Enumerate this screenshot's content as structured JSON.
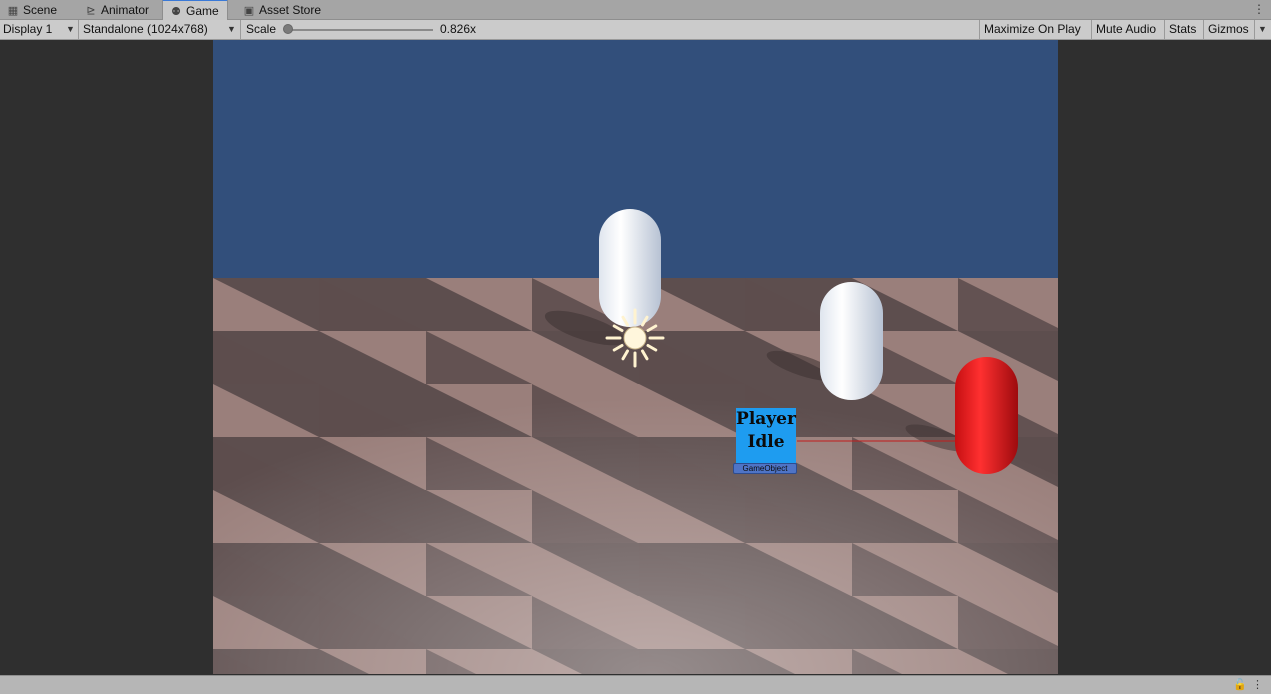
{
  "tabs": [
    {
      "label": "Scene",
      "icon": "grid-icon"
    },
    {
      "label": "Animator",
      "icon": "animator-icon"
    },
    {
      "label": "Game",
      "icon": "gamepad-icon",
      "active": true
    },
    {
      "label": "Asset Store",
      "icon": "shopping-bag-icon"
    }
  ],
  "toolbar": {
    "display": "Display 1",
    "resolution": "Standalone (1024x768)",
    "scale_label": "Scale",
    "scale_value": "0.826x",
    "maximize": "Maximize On Play",
    "mute": "Mute Audio",
    "stats": "Stats",
    "gizmos": "Gizmos"
  },
  "scene": {
    "player_line1": "Player",
    "player_line2": "Idle",
    "tag": "GameObject"
  },
  "colors": {
    "sky": "#324f7b",
    "floor_light": "#9c817d",
    "floor_dark": "#5b4c4c",
    "capsule_white": "#f1f3f6",
    "capsule_red": "#e41e1e",
    "player_box": "#1e9cf0",
    "accent_tab": "#3a79d7"
  }
}
